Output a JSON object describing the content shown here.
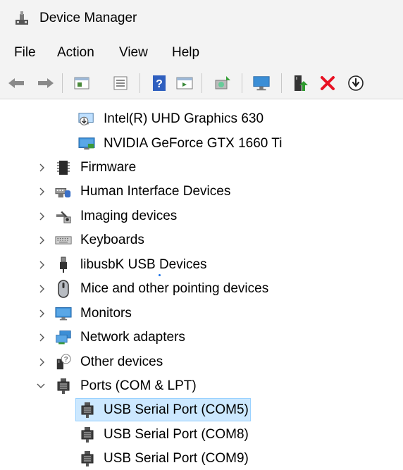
{
  "window": {
    "title": "Device Manager"
  },
  "menu": [
    "File",
    "Action",
    "View",
    "Help"
  ],
  "toolbar": {
    "buttons": [
      "back-arrow-icon",
      "forward-arrow-icon",
      "show-hide-tree-icon",
      "properties-icon",
      "help-icon",
      "run-icon",
      "scan-hardware-icon",
      "display-monitor-icon",
      "update-driver-icon",
      "uninstall-icon",
      "download-icon"
    ]
  },
  "tree": {
    "display_children": [
      "Intel(R) UHD Graphics 630",
      "NVIDIA GeForce GTX 1660 Ti"
    ],
    "categories": [
      {
        "label": "Firmware",
        "icon": "firmware-chip-icon",
        "expanded": false
      },
      {
        "label": "Human Interface Devices",
        "icon": "hid-icon",
        "expanded": false
      },
      {
        "label": "Imaging devices",
        "icon": "camera-icon",
        "expanded": false
      },
      {
        "label": "Keyboards",
        "icon": "keyboard-icon",
        "expanded": false
      },
      {
        "label": "libusbK USB Devices",
        "icon": "usb-plug-icon",
        "expanded": false
      },
      {
        "label": "Mice and other pointing devices",
        "icon": "mouse-icon",
        "expanded": false
      },
      {
        "label": "Monitors",
        "icon": "monitor-icon",
        "expanded": false
      },
      {
        "label": "Network adapters",
        "icon": "network-adapter-icon",
        "expanded": false
      },
      {
        "label": "Other devices",
        "icon": "unknown-device-icon",
        "expanded": false
      },
      {
        "label": "Ports (COM & LPT)",
        "icon": "port-icon",
        "expanded": true
      }
    ],
    "ports_children": [
      "USB Serial Port (COM5)",
      "USB Serial Port (COM8)",
      "USB Serial Port (COM9)"
    ],
    "selected": "USB Serial Port (COM5)"
  },
  "colors": {
    "selection": "#cce8ff",
    "selection_border": "#99d1ff",
    "chrome": "#f3f3f3",
    "uninstall_red": "#e81123"
  }
}
